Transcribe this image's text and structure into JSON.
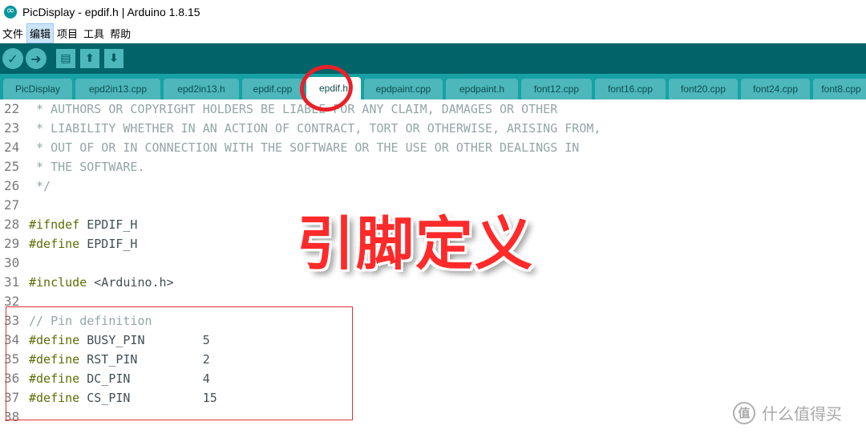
{
  "window": {
    "title": "PicDisplay - epdif.h | Arduino 1.8.15"
  },
  "menu": [
    "文件",
    "编辑",
    "项目",
    "工具",
    "帮助"
  ],
  "toolbar": {
    "verify_icon": "✓",
    "upload_icon": "➜",
    "new_icon": "▤",
    "open_icon": "⬆",
    "save_icon": "⬇"
  },
  "tabs": [
    "PicDisplay",
    "epd2in13.cpp",
    "epd2in13.h",
    "epdif.cpp",
    "epdif.h",
    "epdpaint.cpp",
    "epdpaint.h",
    "font12.cpp",
    "font16.cpp",
    "font20.cpp",
    "font24.cpp",
    "font8.cpp"
  ],
  "selected_tab": "epdif.h",
  "code_lines": [
    {
      "n": "22",
      "segs": [
        {
          "c": "comment",
          "t": " * AUTHORS OR COPYRIGHT HOLDERS BE LIABLE FOR ANY CLAIM, DAMAGES OR OTHER"
        }
      ]
    },
    {
      "n": "23",
      "segs": [
        {
          "c": "comment",
          "t": " * LIABILITY WHETHER IN AN ACTION OF CONTRACT, TORT OR OTHERWISE, ARISING FROM,"
        }
      ]
    },
    {
      "n": "24",
      "segs": [
        {
          "c": "comment",
          "t": " * OUT OF OR IN CONNECTION WITH THE SOFTWARE OR THE USE OR OTHER DEALINGS IN"
        }
      ]
    },
    {
      "n": "25",
      "segs": [
        {
          "c": "comment",
          "t": " * THE SOFTWARE."
        }
      ]
    },
    {
      "n": "26",
      "segs": [
        {
          "c": "comment",
          "t": " */"
        }
      ]
    },
    {
      "n": "27",
      "segs": []
    },
    {
      "n": "28",
      "segs": [
        {
          "c": "kw",
          "t": "#ifndef"
        },
        {
          "c": "plain",
          "t": " EPDIF_H"
        }
      ]
    },
    {
      "n": "29",
      "segs": [
        {
          "c": "kw",
          "t": "#define"
        },
        {
          "c": "plain",
          "t": " EPDIF_H"
        }
      ]
    },
    {
      "n": "30",
      "segs": []
    },
    {
      "n": "31",
      "segs": [
        {
          "c": "kw",
          "t": "#include"
        },
        {
          "c": "plain",
          "t": " <Arduino.h>"
        }
      ]
    },
    {
      "n": "32",
      "segs": []
    },
    {
      "n": "33",
      "segs": [
        {
          "c": "comment",
          "t": "// Pin definition"
        }
      ]
    },
    {
      "n": "34",
      "segs": [
        {
          "c": "kw",
          "t": "#define"
        },
        {
          "c": "plain",
          "t": " BUSY_PIN        5"
        }
      ]
    },
    {
      "n": "35",
      "segs": [
        {
          "c": "kw",
          "t": "#define"
        },
        {
          "c": "plain",
          "t": " RST_PIN         2"
        }
      ]
    },
    {
      "n": "36",
      "segs": [
        {
          "c": "kw",
          "t": "#define"
        },
        {
          "c": "plain",
          "t": " DC_PIN          4"
        }
      ]
    },
    {
      "n": "37",
      "segs": [
        {
          "c": "kw",
          "t": "#define"
        },
        {
          "c": "plain",
          "t": " CS_PIN          15"
        }
      ]
    },
    {
      "n": "38",
      "segs": []
    }
  ],
  "annotation": {
    "label": "引脚定义",
    "color": "#ff2a2a"
  },
  "watermark": {
    "logo": "值",
    "text": "什么值得买"
  },
  "colors": {
    "toolbar": "#006468",
    "tabbar": "#17a1a5",
    "tab": "#4db7bb",
    "keyword": "#5e6d03",
    "comment": "#95a5a6"
  }
}
